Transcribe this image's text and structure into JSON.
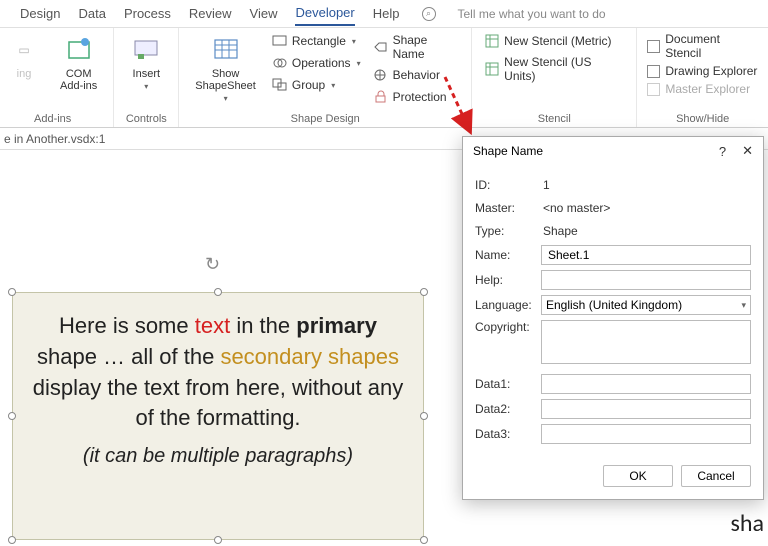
{
  "tabs": {
    "items": [
      "Design",
      "Data",
      "Process",
      "Review",
      "View",
      "Developer",
      "Help"
    ],
    "active": "Developer",
    "tell_me": "Tell me what you want to do"
  },
  "ribbon": {
    "addins": {
      "com": "COM\nAdd-ins",
      "group": "Add-ins"
    },
    "controls": {
      "insert": "Insert",
      "group": "Controls"
    },
    "shapedesign": {
      "show": "Show\nShapeSheet",
      "rectangle": "Rectangle",
      "operations": "Operations",
      "group": "Group",
      "shapename": "Shape Name",
      "behavior": "Behavior",
      "protection": "Protection",
      "grouplabel": "Shape Design"
    },
    "stencil": {
      "metric": "New Stencil (Metric)",
      "us": "New Stencil (US Units)",
      "group": "Stencil"
    },
    "showhide": {
      "doc": "Document Stencil",
      "draw": "Drawing Explorer",
      "master": "Master Explorer",
      "group": "Show/Hide"
    }
  },
  "filebar": {
    "name": "e in Another.vsdx:1"
  },
  "shape": {
    "p1a": "Here is some ",
    "p1b": "text",
    "p1c": " in the ",
    "p1d": "primary",
    "p1e": " shape … all of the ",
    "p1f": "secondary shapes",
    "p1g": " display the text from here, without any of the formatting.",
    "p2": "(it can be multiple paragraphs)"
  },
  "dialog": {
    "title": "Shape Name",
    "id_label": "ID:",
    "id_value": "1",
    "master_label": "Master:",
    "master_value": "<no master>",
    "type_label": "Type:",
    "type_value": "Shape",
    "name_label": "Name:",
    "name_value": "Sheet.1",
    "help_label": "Help:",
    "lang_label": "Language:",
    "lang_value": "English (United Kingdom)",
    "copy_label": "Copyright:",
    "d1_label": "Data1:",
    "d2_label": "Data2:",
    "d3_label": "Data3:",
    "ok": "OK",
    "cancel": "Cancel"
  },
  "bg_text": "sha"
}
